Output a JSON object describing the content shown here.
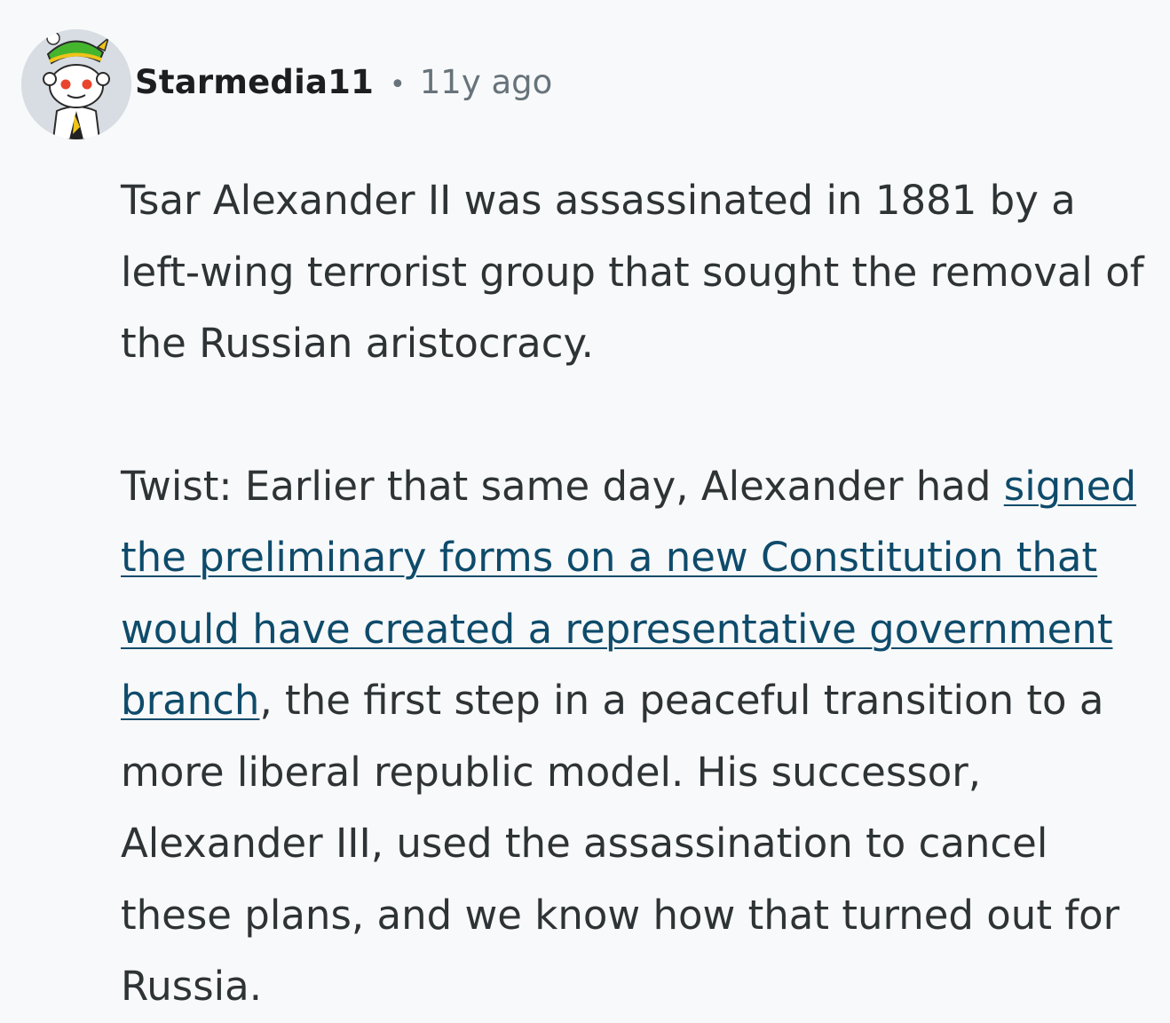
{
  "author": {
    "username": "Starmedia11",
    "separator": "•",
    "timestamp": "11y ago",
    "avatar_icon": "snoo-avatar-icon"
  },
  "comment": {
    "paragraph1": "Tsar Alexander II was assassinated in 1881 by a left-wing terrorist group that sought the removal of the Russian aristocracy.",
    "paragraph2_before_link": "Twist: Earlier that same day, Alexander had ",
    "link_text": "signed the preliminary forms on a new Constitution that would have created a representative government branch",
    "paragraph2_after_link": ", the first step in a peaceful transition to a more liberal republic model. His successor, Alexander III, used the assassination to cancel these plans, and we know how that turned out for Russia."
  },
  "colors": {
    "background": "#f8f9fa",
    "text": "#2e3336",
    "meta": "#67737a",
    "link": "#0e4b6b"
  }
}
